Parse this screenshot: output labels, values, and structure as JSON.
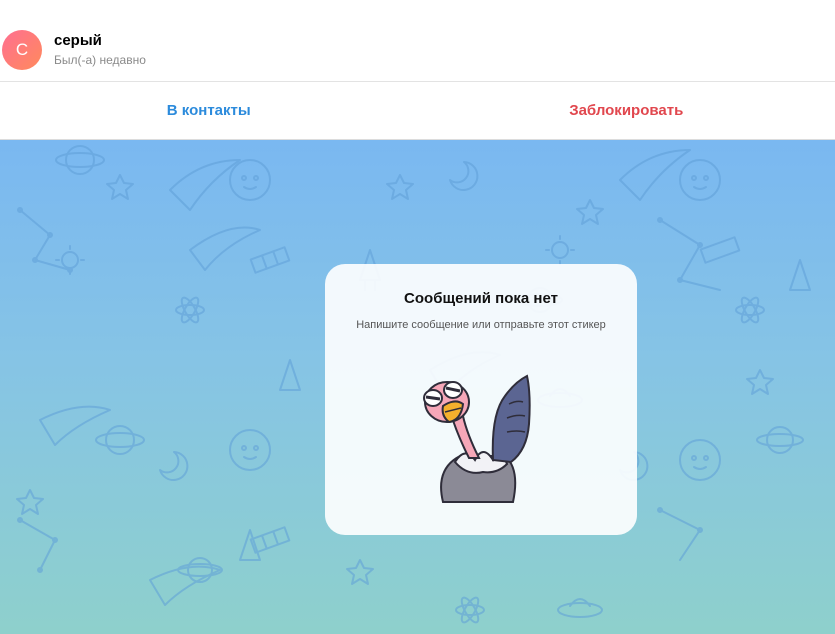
{
  "header": {
    "avatar_letter": "С",
    "contact_name": "серый",
    "status": "Был(-а) недавно"
  },
  "actions": {
    "add_contact": "В контакты",
    "block": "Заблокировать"
  },
  "empty_state": {
    "title": "Сообщений пока нет",
    "subtitle": "Напишите сообщение или отправьте этот стикер",
    "sticker_icon": "ostrich-sticker-icon"
  },
  "colors": {
    "accent_blue": "#2c8bdc",
    "danger_red": "#e1474e",
    "avatar_gradient_start": "#ff6f91",
    "avatar_gradient_end": "#ff8a5c",
    "chat_bg_top": "#7ab8f1",
    "chat_bg_bottom": "#8ed0cc"
  }
}
